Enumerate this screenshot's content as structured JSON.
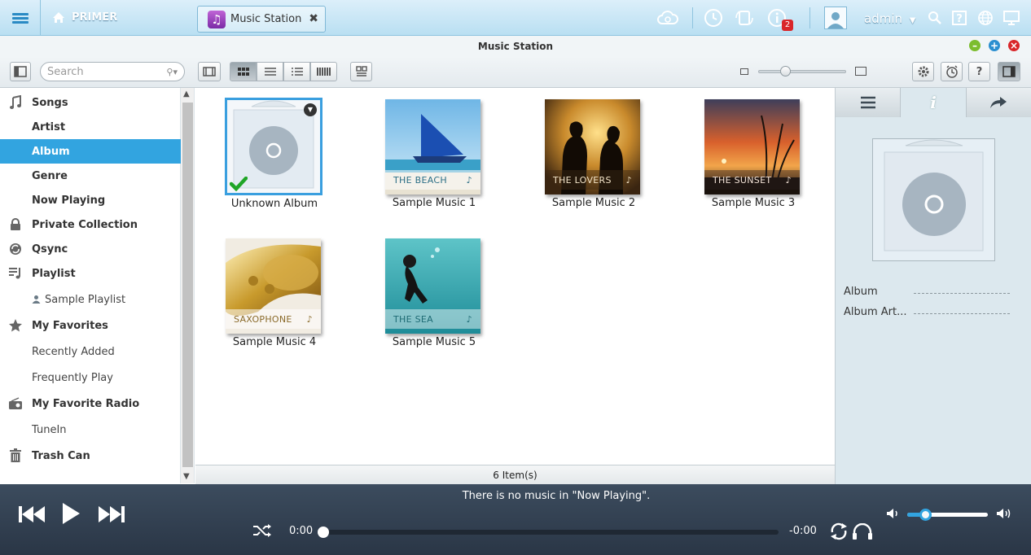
{
  "topbar": {
    "home_label": "PRIMER",
    "app_tab_label": "Music Station",
    "username": "admin",
    "notification_count": "2"
  },
  "window": {
    "title": "Music Station"
  },
  "toolbar": {
    "search_placeholder": "Search"
  },
  "sidebar": {
    "items": [
      {
        "label": "Songs",
        "icon": "music-note-icon"
      },
      {
        "label": "Artist"
      },
      {
        "label": "Album"
      },
      {
        "label": "Genre"
      },
      {
        "label": "Now Playing"
      },
      {
        "label": "Private Collection",
        "icon": "lock-icon"
      },
      {
        "label": "Qsync",
        "icon": "sync-icon"
      },
      {
        "label": "Playlist",
        "icon": "playlist-icon"
      },
      {
        "label": "Sample Playlist",
        "icon": "person-icon"
      },
      {
        "label": "My Favorites",
        "icon": "star-icon"
      },
      {
        "label": "Recently Added"
      },
      {
        "label": "Frequently Play"
      },
      {
        "label": "My Favorite Radio",
        "icon": "radio-icon"
      },
      {
        "label": "TuneIn"
      },
      {
        "label": "Trash Can",
        "icon": "trash-icon"
      }
    ]
  },
  "albums": [
    {
      "title": "Unknown Album",
      "band": ""
    },
    {
      "title": "Sample Music 1",
      "band": "THE BEACH"
    },
    {
      "title": "Sample Music 2",
      "band": "THE LOVERS"
    },
    {
      "title": "Sample Music 3",
      "band": "THE SUNSET"
    },
    {
      "title": "Sample Music 4",
      "band": "SAXOPHONE"
    },
    {
      "title": "Sample Music 5",
      "band": "THE SEA"
    }
  ],
  "status": {
    "item_count": "6 Item(s)"
  },
  "info_panel": {
    "fields": [
      {
        "label": "Album"
      },
      {
        "label": "Album Art..."
      }
    ]
  },
  "player": {
    "now_playing_message": "There is no music in \"Now Playing\".",
    "elapsed": "0:00",
    "remaining": "-0:00",
    "progress_fraction": 0,
    "volume_fraction": 0.23
  },
  "colors": {
    "accent": "#32a4e0",
    "player_bg": "#2f3b4b",
    "selected_bg": "#32a4e0"
  }
}
